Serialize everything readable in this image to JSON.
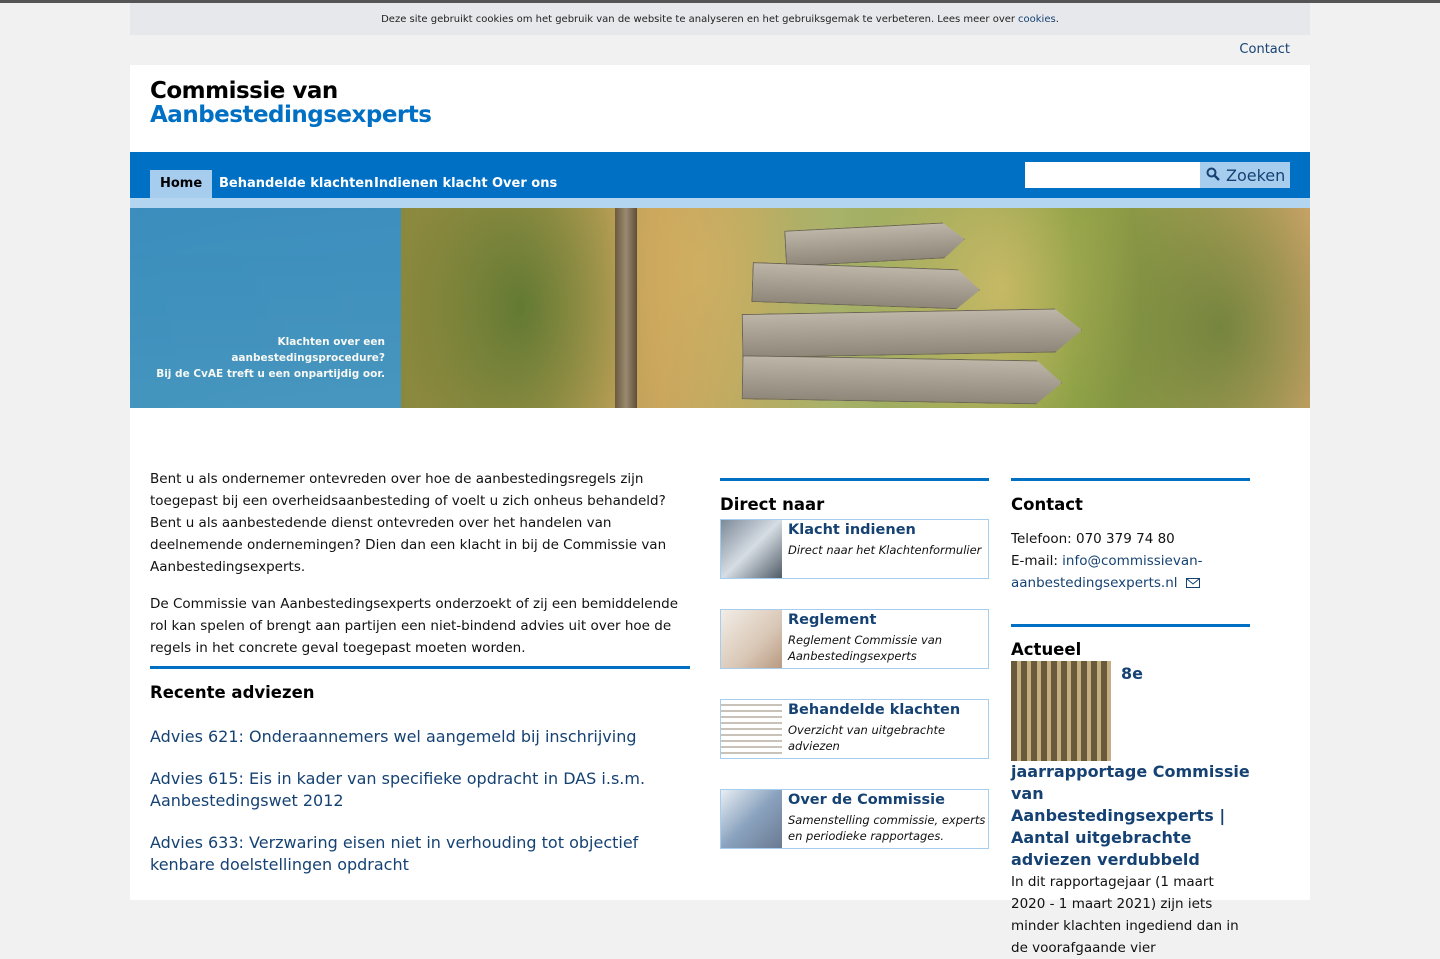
{
  "cookie_bar": {
    "text": "Deze site gebruikt cookies om het gebruik van de website te analyseren en het gebruiksgemak te verbeteren. Lees meer over",
    "link": "cookies",
    "end": "."
  },
  "topbar": {
    "contact": "Contact"
  },
  "logo": {
    "line1": "Commissie van",
    "line2": "Aanbestedingsexperts"
  },
  "nav": {
    "items": [
      "Home",
      "Behandelde klachten",
      "Indienen klacht",
      "Over ons"
    ],
    "search_button": "Zoeken"
  },
  "hero": {
    "line1": "Klachten over een aanbestedingsprocedure?",
    "line2": "Bij de CvAE treft u een onpartijdig oor."
  },
  "intro": {
    "p1": "Bent u als ondernemer ontevreden over hoe de aanbestedingsregels zijn toegepast bij een overheidsaanbesteding of voelt u zich onheus behandeld? Bent u als aanbestedende dienst ontevreden over het handelen van deelnemende ondernemingen? Dien dan een klacht in bij de Commissie van Aanbestedingsexperts.",
    "p2": "De Commissie van Aanbestedingsexperts onderzoekt of zij een bemiddelende rol kan spelen of brengt aan partijen een niet-bindend advies uit over hoe de regels in het concrete geval toegepast moeten worden."
  },
  "recent": {
    "title": "Recente adviezen",
    "items": [
      "Advies 621: Onderaannemers wel aangemeld bij inschrijving",
      "Advies 615: Eis in kader van specifieke opdracht in DAS i.s.m. Aanbestedingswet 2012",
      "Advies 633: Verzwaring eisen niet in verhouding tot objectief kenbare doelstellingen opdracht"
    ]
  },
  "direct": {
    "title": "Direct naar",
    "tiles": [
      {
        "title": "Klacht indienen",
        "desc": "Direct naar het Klachtenformulier"
      },
      {
        "title": "Reglement",
        "desc": "Reglement Commissie van Aanbestedingsexperts"
      },
      {
        "title": "Behandelde klachten",
        "desc": "Overzicht van uitgebrachte adviezen"
      },
      {
        "title": "Over de Commissie",
        "desc": "Samenstelling commissie, experts en periodieke rapportages."
      }
    ]
  },
  "contact": {
    "title": "Contact",
    "phone": "Telefoon: 070 379 74 80",
    "email_label": "E-mail:",
    "email": "info@commissievan-aanbestedingsexperts.nl"
  },
  "actueel": {
    "title": "Actueel",
    "headline": "8e jaarrapportage Commissie van Aanbestedingsexperts | Aantal uitgebrachte adviezen verdubbeld",
    "text": "In dit rapportagejaar (1 maart 2020 - 1 maart 2021) zijn iets minder klachten ingediend dan in de voorafgaande vier"
  },
  "colors": {
    "brand_blue": "#0070c4",
    "link_blue": "#154273",
    "light_blue": "#a7cdee"
  }
}
